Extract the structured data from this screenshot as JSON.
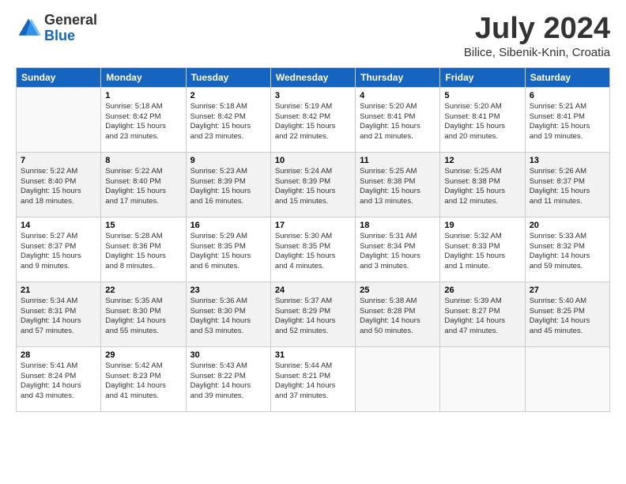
{
  "logo": {
    "general": "General",
    "blue": "Blue"
  },
  "title": "July 2024",
  "subtitle": "Bilice, Sibenik-Knin, Croatia",
  "headers": [
    "Sunday",
    "Monday",
    "Tuesday",
    "Wednesday",
    "Thursday",
    "Friday",
    "Saturday"
  ],
  "weeks": [
    [
      {
        "num": "",
        "info": ""
      },
      {
        "num": "1",
        "info": "Sunrise: 5:18 AM\nSunset: 8:42 PM\nDaylight: 15 hours\nand 23 minutes."
      },
      {
        "num": "2",
        "info": "Sunrise: 5:18 AM\nSunset: 8:42 PM\nDaylight: 15 hours\nand 23 minutes."
      },
      {
        "num": "3",
        "info": "Sunrise: 5:19 AM\nSunset: 8:42 PM\nDaylight: 15 hours\nand 22 minutes."
      },
      {
        "num": "4",
        "info": "Sunrise: 5:20 AM\nSunset: 8:41 PM\nDaylight: 15 hours\nand 21 minutes."
      },
      {
        "num": "5",
        "info": "Sunrise: 5:20 AM\nSunset: 8:41 PM\nDaylight: 15 hours\nand 20 minutes."
      },
      {
        "num": "6",
        "info": "Sunrise: 5:21 AM\nSunset: 8:41 PM\nDaylight: 15 hours\nand 19 minutes."
      }
    ],
    [
      {
        "num": "7",
        "info": "Sunrise: 5:22 AM\nSunset: 8:40 PM\nDaylight: 15 hours\nand 18 minutes."
      },
      {
        "num": "8",
        "info": "Sunrise: 5:22 AM\nSunset: 8:40 PM\nDaylight: 15 hours\nand 17 minutes."
      },
      {
        "num": "9",
        "info": "Sunrise: 5:23 AM\nSunset: 8:39 PM\nDaylight: 15 hours\nand 16 minutes."
      },
      {
        "num": "10",
        "info": "Sunrise: 5:24 AM\nSunset: 8:39 PM\nDaylight: 15 hours\nand 15 minutes."
      },
      {
        "num": "11",
        "info": "Sunrise: 5:25 AM\nSunset: 8:38 PM\nDaylight: 15 hours\nand 13 minutes."
      },
      {
        "num": "12",
        "info": "Sunrise: 5:25 AM\nSunset: 8:38 PM\nDaylight: 15 hours\nand 12 minutes."
      },
      {
        "num": "13",
        "info": "Sunrise: 5:26 AM\nSunset: 8:37 PM\nDaylight: 15 hours\nand 11 minutes."
      }
    ],
    [
      {
        "num": "14",
        "info": "Sunrise: 5:27 AM\nSunset: 8:37 PM\nDaylight: 15 hours\nand 9 minutes."
      },
      {
        "num": "15",
        "info": "Sunrise: 5:28 AM\nSunset: 8:36 PM\nDaylight: 15 hours\nand 8 minutes."
      },
      {
        "num": "16",
        "info": "Sunrise: 5:29 AM\nSunset: 8:35 PM\nDaylight: 15 hours\nand 6 minutes."
      },
      {
        "num": "17",
        "info": "Sunrise: 5:30 AM\nSunset: 8:35 PM\nDaylight: 15 hours\nand 4 minutes."
      },
      {
        "num": "18",
        "info": "Sunrise: 5:31 AM\nSunset: 8:34 PM\nDaylight: 15 hours\nand 3 minutes."
      },
      {
        "num": "19",
        "info": "Sunrise: 5:32 AM\nSunset: 8:33 PM\nDaylight: 15 hours\nand 1 minute."
      },
      {
        "num": "20",
        "info": "Sunrise: 5:33 AM\nSunset: 8:32 PM\nDaylight: 14 hours\nand 59 minutes."
      }
    ],
    [
      {
        "num": "21",
        "info": "Sunrise: 5:34 AM\nSunset: 8:31 PM\nDaylight: 14 hours\nand 57 minutes."
      },
      {
        "num": "22",
        "info": "Sunrise: 5:35 AM\nSunset: 8:30 PM\nDaylight: 14 hours\nand 55 minutes."
      },
      {
        "num": "23",
        "info": "Sunrise: 5:36 AM\nSunset: 8:30 PM\nDaylight: 14 hours\nand 53 minutes."
      },
      {
        "num": "24",
        "info": "Sunrise: 5:37 AM\nSunset: 8:29 PM\nDaylight: 14 hours\nand 52 minutes."
      },
      {
        "num": "25",
        "info": "Sunrise: 5:38 AM\nSunset: 8:28 PM\nDaylight: 14 hours\nand 50 minutes."
      },
      {
        "num": "26",
        "info": "Sunrise: 5:39 AM\nSunset: 8:27 PM\nDaylight: 14 hours\nand 47 minutes."
      },
      {
        "num": "27",
        "info": "Sunrise: 5:40 AM\nSunset: 8:25 PM\nDaylight: 14 hours\nand 45 minutes."
      }
    ],
    [
      {
        "num": "28",
        "info": "Sunrise: 5:41 AM\nSunset: 8:24 PM\nDaylight: 14 hours\nand 43 minutes."
      },
      {
        "num": "29",
        "info": "Sunrise: 5:42 AM\nSunset: 8:23 PM\nDaylight: 14 hours\nand 41 minutes."
      },
      {
        "num": "30",
        "info": "Sunrise: 5:43 AM\nSunset: 8:22 PM\nDaylight: 14 hours\nand 39 minutes."
      },
      {
        "num": "31",
        "info": "Sunrise: 5:44 AM\nSunset: 8:21 PM\nDaylight: 14 hours\nand 37 minutes."
      },
      {
        "num": "",
        "info": ""
      },
      {
        "num": "",
        "info": ""
      },
      {
        "num": "",
        "info": ""
      }
    ]
  ]
}
